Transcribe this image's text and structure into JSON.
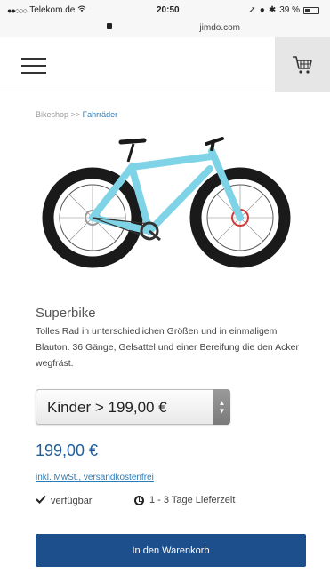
{
  "status_bar": {
    "carrier": "Telekom.de",
    "time": "20:50",
    "battery": "39 %"
  },
  "browser": {
    "url": "jimdo.com"
  },
  "header": {
    "menu_icon": "hamburger-icon",
    "cart_icon": "shopping-cart-icon"
  },
  "breadcrumb": {
    "root": "Bikeshop",
    "separator": ">>",
    "current": "Fahrräder"
  },
  "product": {
    "title": "Superbike",
    "description": "Tolles Rad in unterschiedlichen Größen und in einmaligem Blauton. 36 Gänge, Gelsattel und einer Bereifung die den Acker wegfräst.",
    "variant_selected": "Kinder > 199,00 €",
    "price": "199,00 €",
    "tax_note": "inkl. MwSt., versandkostenfrei",
    "availability": "verfügbar",
    "delivery_time": "1 - 3 Tage Lieferzeit",
    "add_to_cart_label": "In den Warenkorb",
    "image_colors": {
      "frame": "#7fd3e6",
      "tire": "#1a1a1a",
      "accent": "#d23a3a"
    }
  }
}
